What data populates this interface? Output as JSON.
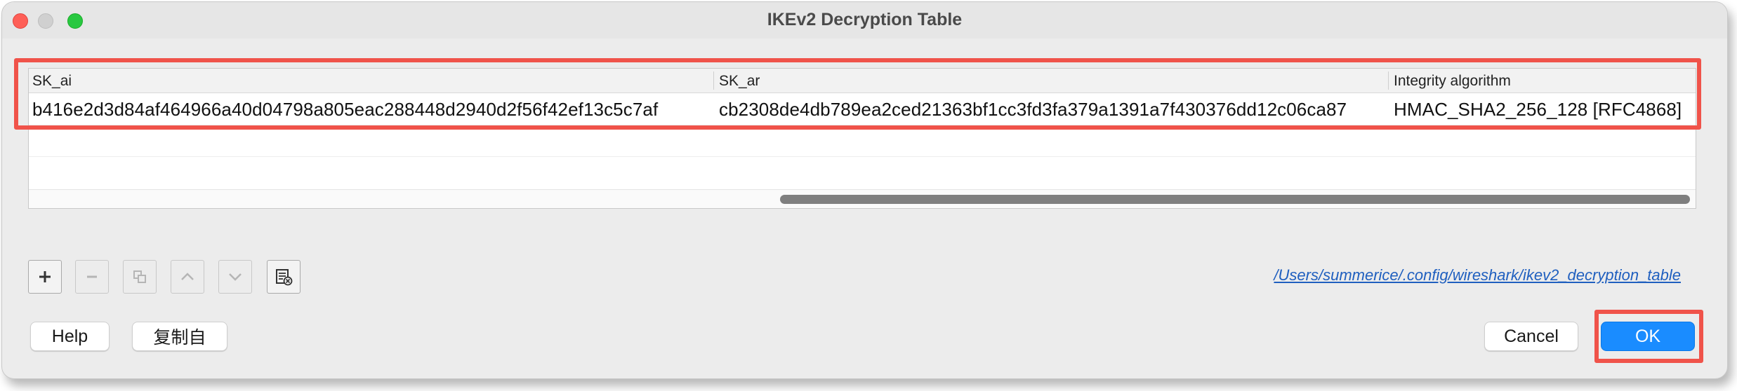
{
  "window": {
    "title": "IKEv2 Decryption Table"
  },
  "table": {
    "columns": [
      "SK_ai",
      "SK_ar",
      "Integrity algorithm"
    ],
    "rows": [
      {
        "sk_ai": "b416e2d3d84af464966a40d04798a805eac288448d2940d2f56f42ef13c5c7af",
        "sk_ar": "cb2308de4db789ea2ced21363bf1cc3fd3fa379a1391a7f430376dd12c06ca87",
        "integrity": "HMAC_SHA2_256_128 [RFC4868]"
      }
    ]
  },
  "toolbar": {
    "icons": [
      "plus-icon",
      "minus-icon",
      "copy-icon",
      "chevron-up-icon",
      "chevron-down-icon",
      "clear-table-icon"
    ]
  },
  "file_path": "/Users/summerice/.config/wireshark/ikev2_decryption_table",
  "buttons": {
    "help": "Help",
    "copy_from": "复制自",
    "cancel": "Cancel",
    "ok": "OK"
  },
  "colors": {
    "highlight": "#f0534a",
    "primary_button": "#1a8cff",
    "link": "#1f5fbf"
  }
}
